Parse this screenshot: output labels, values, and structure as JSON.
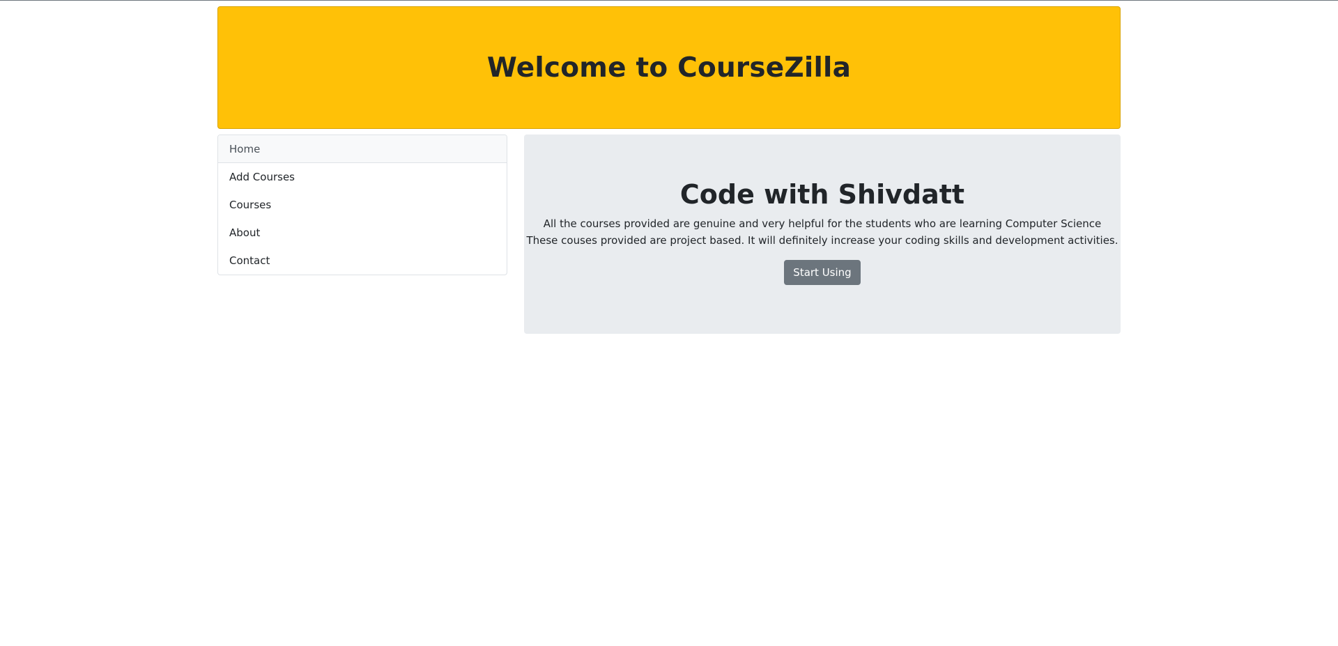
{
  "header": {
    "title": "Welcome to CourseZilla"
  },
  "sidebar": {
    "items": [
      {
        "label": "Home",
        "active": true
      },
      {
        "label": "Add Courses",
        "active": false
      },
      {
        "label": "Courses",
        "active": false
      },
      {
        "label": "About",
        "active": false
      },
      {
        "label": "Contact",
        "active": false
      }
    ]
  },
  "main": {
    "heading": "Code with Shivdatt",
    "line1": "All the courses provided are genuine and very helpful for the students who are learning Computer Science",
    "line2": "These couses provided are project based. It will definitely increase your coding skills and development activities.",
    "button_label": "Start Using"
  },
  "colors": {
    "banner": "#ffc107",
    "jumbotron": "#e9ecef",
    "button": "#6c757d"
  }
}
